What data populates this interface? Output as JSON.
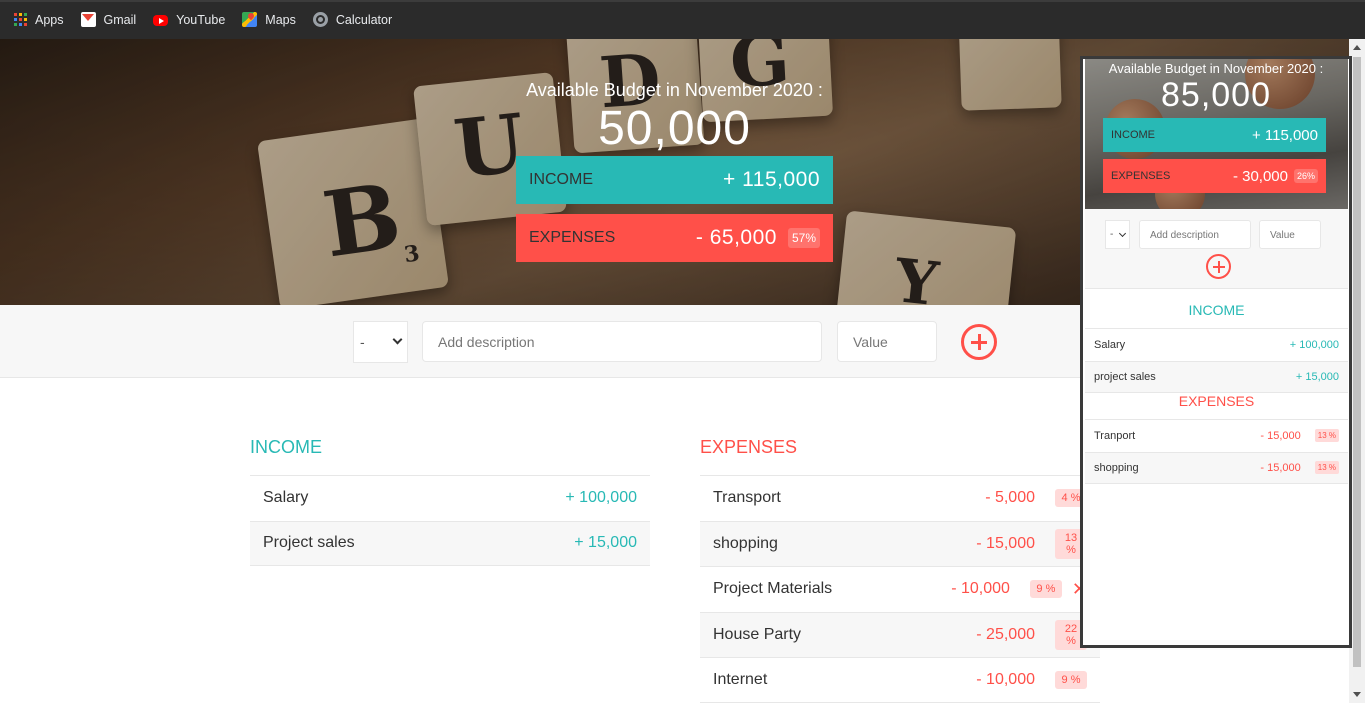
{
  "bookmarks": [
    {
      "label": "Apps",
      "icon": "apps-icon"
    },
    {
      "label": "Gmail",
      "icon": "gmail-icon"
    },
    {
      "label": "YouTube",
      "icon": "youtube-icon"
    },
    {
      "label": "Maps",
      "icon": "maps-icon"
    },
    {
      "label": "Calculator",
      "icon": "calculator-icon"
    }
  ],
  "colors": {
    "income": "#28b9b5",
    "expenses": "#ff5049"
  },
  "hero": {
    "title": "Available Budget in November 2020 :",
    "budget": "50,000",
    "income_label": "INCOME",
    "income_value": "+ 115,000",
    "expenses_label": "EXPENSES",
    "expenses_value": "- 65,000",
    "expenses_pct": "57%"
  },
  "add_form": {
    "type_value": "-",
    "description_placeholder": "Add description",
    "value_placeholder": "Value"
  },
  "income": {
    "title": "INCOME",
    "items": [
      {
        "description": "Salary",
        "value": "+ 100,000"
      },
      {
        "description": "Project sales",
        "value": "+ 15,000"
      }
    ]
  },
  "expenses": {
    "title": "EXPENSES",
    "items": [
      {
        "description": "Transport",
        "value": "- 5,000",
        "pct": "4 %"
      },
      {
        "description": "shopping",
        "value": "- 15,000",
        "pct": "13 %"
      },
      {
        "description": "Project Materials",
        "value": "- 10,000",
        "pct": "9 %",
        "delete": "✕"
      },
      {
        "description": "House Party",
        "value": "- 25,000",
        "pct": "22 %"
      },
      {
        "description": "Internet",
        "value": "- 10,000",
        "pct": "9 %"
      }
    ]
  },
  "mobile": {
    "title": "Available Budget in November 2020 :",
    "budget": "85,000",
    "income_label": "INCOME",
    "income_value": "+ 115,000",
    "expenses_label": "EXPENSES",
    "expenses_value": "- 30,000",
    "expenses_pct": "26%",
    "type_value": "-",
    "description_placeholder": "Add description",
    "value_placeholder": "Value",
    "income_title": "INCOME",
    "expenses_title": "EXPENSES",
    "income_items": [
      {
        "description": "Salary",
        "value": "+ 100,000"
      },
      {
        "description": "project sales",
        "value": "+ 15,000"
      }
    ],
    "expense_items": [
      {
        "description": "Tranport",
        "value": "- 15,000",
        "pct": "13 %"
      },
      {
        "description": "shopping",
        "value": "- 15,000",
        "pct": "13 %"
      }
    ]
  }
}
